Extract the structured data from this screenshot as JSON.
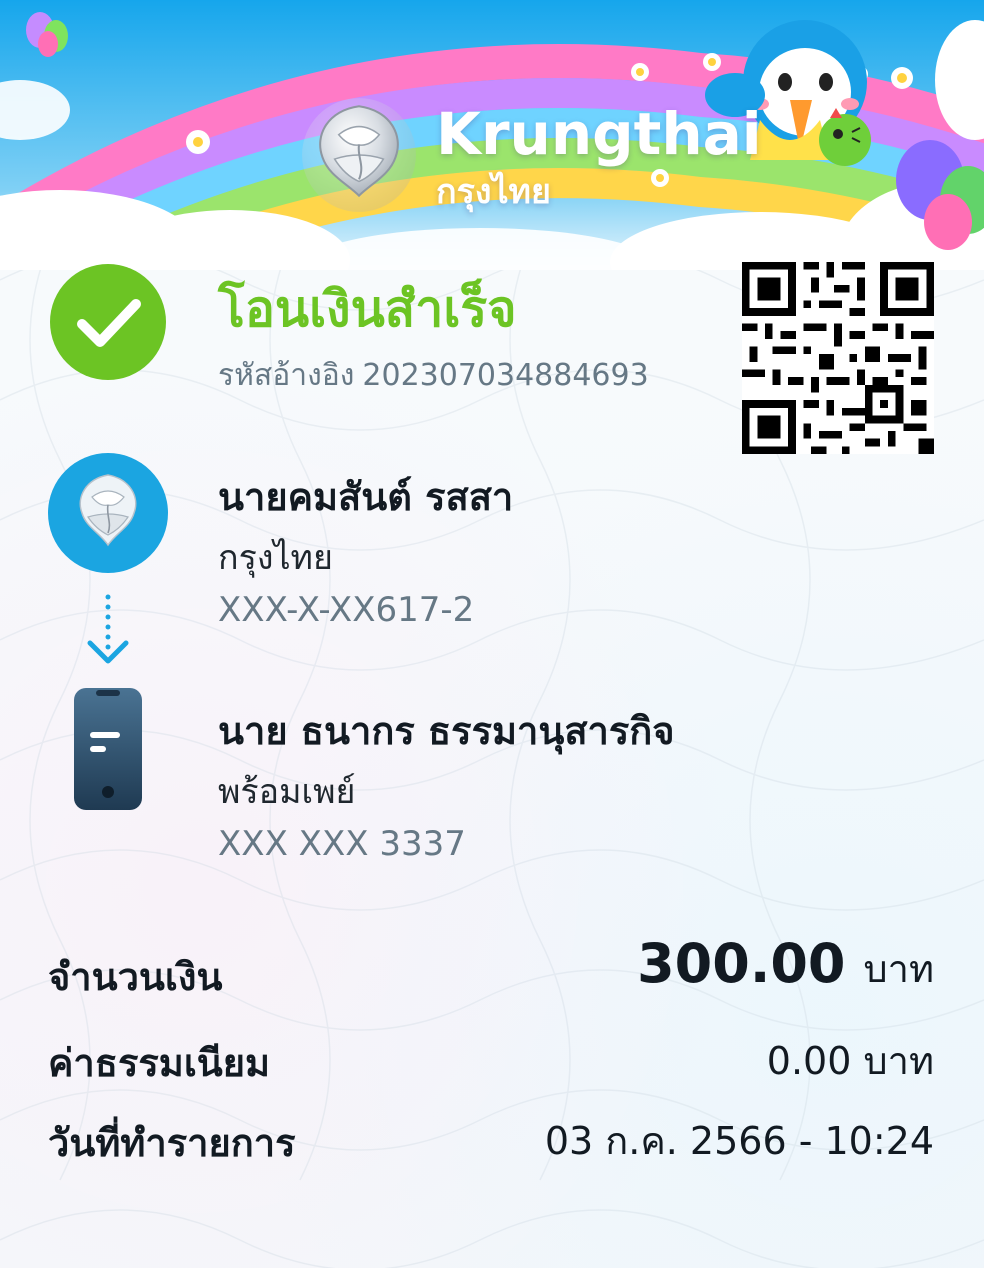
{
  "header": {
    "brand_en": "Krungthai",
    "brand_th": "กรุงไทย"
  },
  "status": {
    "title": "โอนเงินสำเร็จ",
    "ref_label": "รหัสอ้างอิง",
    "ref_value": "2023070348846​93"
  },
  "sender": {
    "name": "นายคมสันต์ รสสา",
    "bank": "กรุงไทย",
    "account": "XXX-X-XX617-2"
  },
  "receiver": {
    "name": "นาย ธนากร ธรรมานุสารกิจ",
    "channel": "พร้อมเพย์",
    "account": "XXX XXX 3337"
  },
  "summary": {
    "amount_label": "จำนวนเงิน",
    "amount_value": "300.00",
    "amount_unit": "บาท",
    "fee_label": "ค่าธรรมเนียม",
    "fee_value": "0.00 บาท",
    "date_label": "วันที่ทำรายการ",
    "date_value": "03 ก.ค. 2566 - 10:24"
  },
  "colors": {
    "success_green": "#6cc424",
    "brand_blue": "#1ba5e1",
    "muted_text": "#667885",
    "phone_dark": "#2c4a63"
  },
  "icons": {
    "success": "check-circle-icon",
    "bank": "krungthai-phoenix-logo",
    "arrow": "dotted-arrow-down-icon",
    "phone": "smartphone-icon",
    "qr": "qr-code"
  }
}
